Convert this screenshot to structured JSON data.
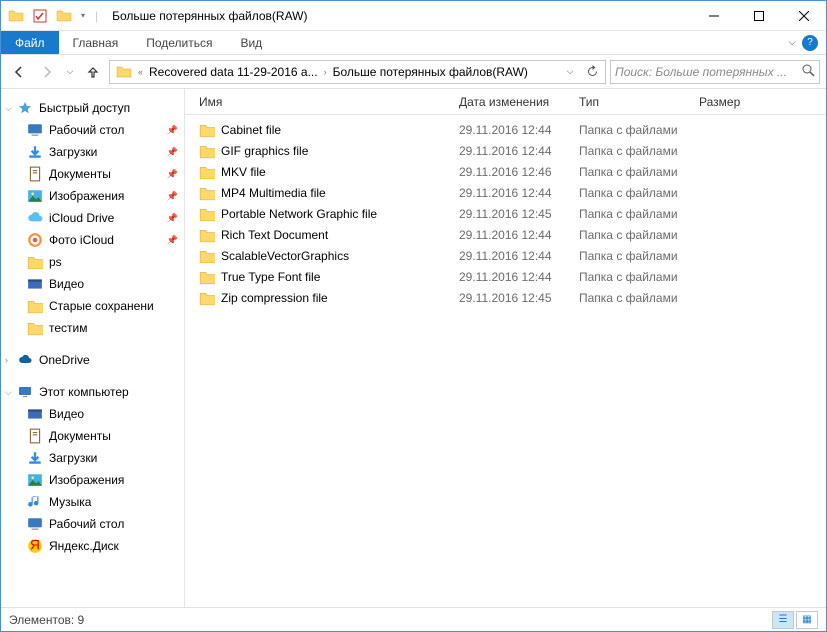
{
  "window": {
    "title": "Больше потерянных файлов(RAW)"
  },
  "ribbon": {
    "file": "Файл",
    "tabs": [
      "Главная",
      "Поделиться",
      "Вид"
    ]
  },
  "breadcrumb": {
    "prefix": "«",
    "segments": [
      "Recovered data 11-29-2016 a...",
      "Больше потерянных файлов(RAW)"
    ]
  },
  "search": {
    "placeholder": "Поиск: Больше потерянных ..."
  },
  "sidebar": {
    "quick_access": "Быстрый доступ",
    "quick_items": [
      {
        "label": "Рабочий стол",
        "pinned": true,
        "icon": "desktop"
      },
      {
        "label": "Загрузки",
        "pinned": true,
        "icon": "downloads"
      },
      {
        "label": "Документы",
        "pinned": true,
        "icon": "documents"
      },
      {
        "label": "Изображения",
        "pinned": true,
        "icon": "pictures"
      },
      {
        "label": "iCloud Drive",
        "pinned": true,
        "icon": "icloud"
      },
      {
        "label": "Фото iCloud",
        "pinned": true,
        "icon": "icloud-photo"
      },
      {
        "label": "ps",
        "pinned": false,
        "icon": "folder"
      },
      {
        "label": "Видео",
        "pinned": false,
        "icon": "video"
      },
      {
        "label": "Старые сохранени",
        "pinned": false,
        "icon": "folder"
      },
      {
        "label": "тестим",
        "pinned": false,
        "icon": "folder"
      }
    ],
    "onedrive": "OneDrive",
    "this_pc": "Этот компьютер",
    "pc_items": [
      {
        "label": "Видео",
        "icon": "video"
      },
      {
        "label": "Документы",
        "icon": "documents"
      },
      {
        "label": "Загрузки",
        "icon": "downloads"
      },
      {
        "label": "Изображения",
        "icon": "pictures"
      },
      {
        "label": "Музыка",
        "icon": "music"
      },
      {
        "label": "Рабочий стол",
        "icon": "desktop"
      },
      {
        "label": "Яндекс.Диск",
        "icon": "yandex"
      }
    ]
  },
  "columns": {
    "name": "Имя",
    "date": "Дата изменения",
    "type": "Тип",
    "size": "Размер"
  },
  "files": [
    {
      "name": "Cabinet file",
      "date": "29.11.2016 12:44",
      "type": "Папка с файлами"
    },
    {
      "name": "GIF graphics file",
      "date": "29.11.2016 12:44",
      "type": "Папка с файлами"
    },
    {
      "name": "MKV file",
      "date": "29.11.2016 12:46",
      "type": "Папка с файлами"
    },
    {
      "name": "MP4 Multimedia file",
      "date": "29.11.2016 12:44",
      "type": "Папка с файлами"
    },
    {
      "name": "Portable Network Graphic file",
      "date": "29.11.2016 12:45",
      "type": "Папка с файлами"
    },
    {
      "name": "Rich Text Document",
      "date": "29.11.2016 12:44",
      "type": "Папка с файлами"
    },
    {
      "name": "ScalableVectorGraphics",
      "date": "29.11.2016 12:44",
      "type": "Папка с файлами"
    },
    {
      "name": "True Type Font file",
      "date": "29.11.2016 12:44",
      "type": "Папка с файлами"
    },
    {
      "name": "Zip compression file",
      "date": "29.11.2016 12:45",
      "type": "Папка с файлами"
    }
  ],
  "status": {
    "text": "Элементов: 9"
  }
}
